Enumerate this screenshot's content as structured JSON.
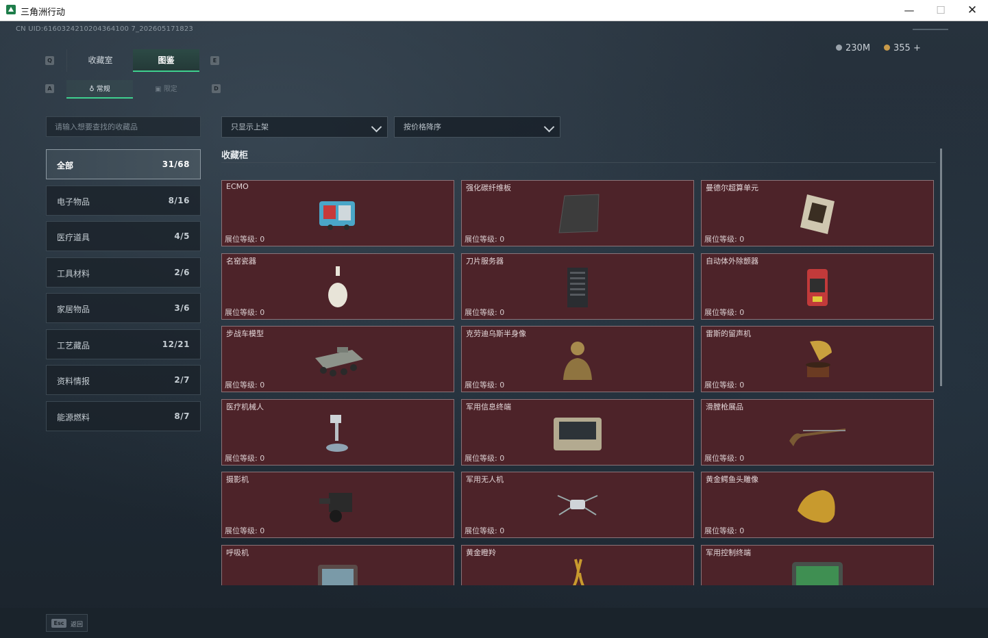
{
  "window": {
    "title": "三角洲行动",
    "minimize": "—",
    "maximize": "☐",
    "close": "✕"
  },
  "uid": "CN UID:6160324210204364100 7_202605171823",
  "currency": {
    "silver": "230M",
    "gold": "355 +"
  },
  "tabs": {
    "key_left": "Q",
    "key_right": "E",
    "collection_room": "收藏室",
    "encyclopedia": "图鉴"
  },
  "subtabs": {
    "key_left": "A",
    "key_right": "D",
    "normal": "常规",
    "limited": "限定"
  },
  "search": {
    "placeholder": "请输入想要查找的收藏品"
  },
  "filters": {
    "shelf": "只显示上架",
    "sort": "按价格降序"
  },
  "categories": [
    {
      "name": "全部",
      "count": "31/68"
    },
    {
      "name": "电子物品",
      "count": "8/16"
    },
    {
      "name": "医疗道具",
      "count": "4/5"
    },
    {
      "name": "工具材料",
      "count": "2/6"
    },
    {
      "name": "家居物品",
      "count": "3/6"
    },
    {
      "name": "工艺藏品",
      "count": "12/21"
    },
    {
      "name": "资料情报",
      "count": "2/7"
    },
    {
      "name": "能源燃料",
      "count": "8/7"
    }
  ],
  "section_title": "收藏柜",
  "level_label": "展位等级: 0",
  "items": [
    {
      "name": "ECMO",
      "icon": "ecmo-machine"
    },
    {
      "name": "强化碳纤维板",
      "icon": "carbon-fiber-plate"
    },
    {
      "name": "曼德尔超算单元",
      "icon": "supercomputer-unit"
    },
    {
      "name": "名窑瓷器",
      "icon": "porcelain-vase"
    },
    {
      "name": "刀片服务器",
      "icon": "blade-server"
    },
    {
      "name": "自动体外除颤器",
      "icon": "defibrillator"
    },
    {
      "name": "步战车模型",
      "icon": "ifv-model"
    },
    {
      "name": "克劳迪乌斯半身像",
      "icon": "bust-statue"
    },
    {
      "name": "雷斯的留声机",
      "icon": "gramophone"
    },
    {
      "name": "医疗机械人",
      "icon": "medical-robot"
    },
    {
      "name": "军用信息终端",
      "icon": "military-terminal"
    },
    {
      "name": "滑膛枪展品",
      "icon": "musket"
    },
    {
      "name": "摄影机",
      "icon": "video-camera"
    },
    {
      "name": "军用无人机",
      "icon": "drone"
    },
    {
      "name": "黄金鳄鱼头雕像",
      "icon": "gold-crocodile-head"
    },
    {
      "name": "呼吸机",
      "icon": "ventilator"
    },
    {
      "name": "黄金瞪羚",
      "icon": "gold-gazelle"
    },
    {
      "name": "军用控制终端",
      "icon": "control-terminal"
    }
  ],
  "footer": {
    "esc_key": "Esc",
    "back": "返回"
  }
}
